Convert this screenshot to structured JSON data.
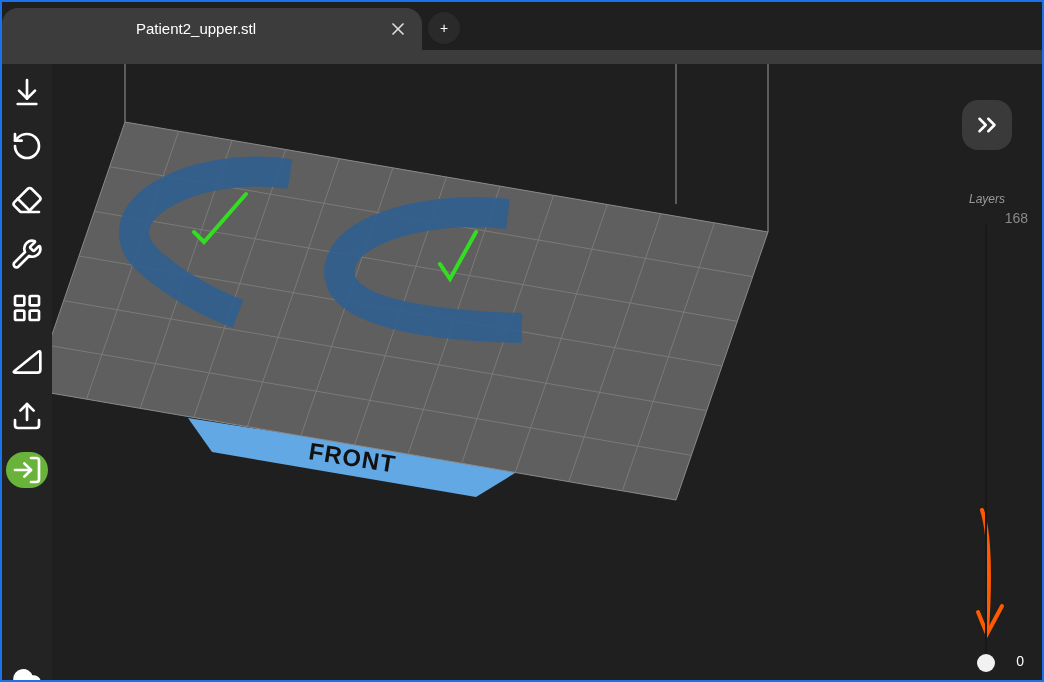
{
  "tabs": [
    {
      "label": "Patient2_upper.stl",
      "selected": true
    }
  ],
  "new_tab": {
    "label": "+"
  },
  "toolbar": {
    "tools": [
      {
        "active": false
      },
      {
        "active": false
      },
      {
        "active": false
      },
      {
        "active": false
      },
      {
        "active": false
      },
      {
        "active": false
      },
      {
        "active": false
      },
      {
        "active": true
      }
    ]
  },
  "viewport": {
    "platform_label": "FRONT"
  },
  "layers": {
    "label": "Layers",
    "top_reading": "168",
    "bottom_reading": "0",
    "level": 0
  }
}
